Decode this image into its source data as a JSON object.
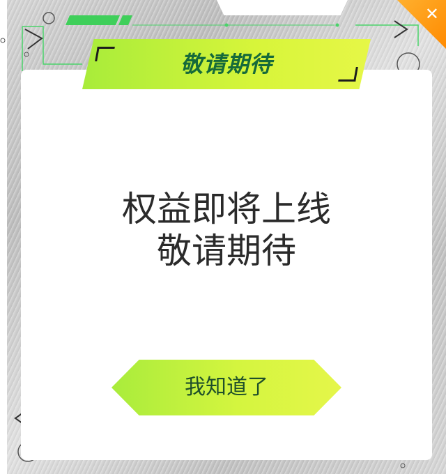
{
  "dialog": {
    "banner_title": "敬请期待",
    "message_line1": "权益即将上线",
    "message_line2": "敬请期待",
    "ack_button_label": "我知道了",
    "close_icon": "close-icon"
  },
  "colors": {
    "accent_green": "#c9f23c",
    "title_text": "#166a3a",
    "close_orange": "#ff9a1a",
    "message_text": "#2a2a2a"
  }
}
